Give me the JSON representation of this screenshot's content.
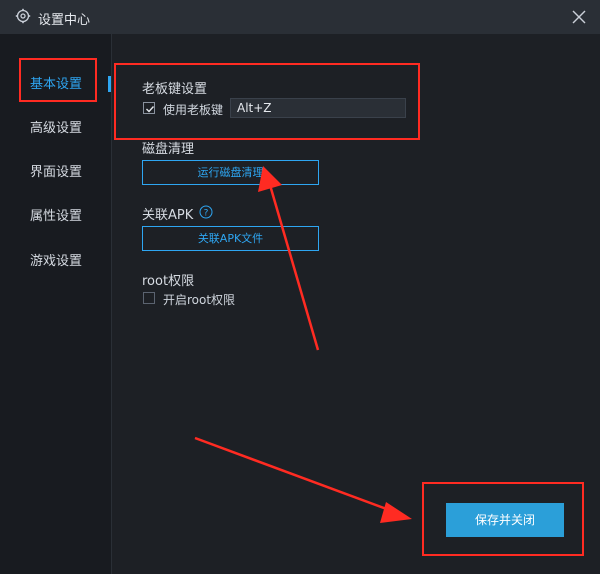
{
  "window": {
    "title": "设置中心",
    "title_icon": "gear-icon",
    "close_icon": "close-icon"
  },
  "sidebar": {
    "items": [
      {
        "label": "基本设置",
        "active": true
      },
      {
        "label": "高级设置",
        "active": false
      },
      {
        "label": "界面设置",
        "active": false
      },
      {
        "label": "属性设置",
        "active": false
      },
      {
        "label": "游戏设置",
        "active": false
      }
    ]
  },
  "boss_key": {
    "section_title": "老板键设置",
    "checkbox_label": "使用老板键",
    "checked": true,
    "hotkey_value": "Alt+Z"
  },
  "disk_cleanup": {
    "section_title": "磁盘清理",
    "button_label": "运行磁盘清理"
  },
  "apk": {
    "section_title": "关联APK",
    "help_icon": "help-circle-icon",
    "button_label": "关联APK文件"
  },
  "root": {
    "section_title": "root权限",
    "checkbox_label": "开启root权限",
    "checked": false
  },
  "footer": {
    "save_label": "保存并关闭"
  },
  "colors": {
    "accent": "#2ea6f2",
    "highlight": "#ff2b22",
    "background": "#1d2025",
    "save_button": "#2b9fd9"
  }
}
